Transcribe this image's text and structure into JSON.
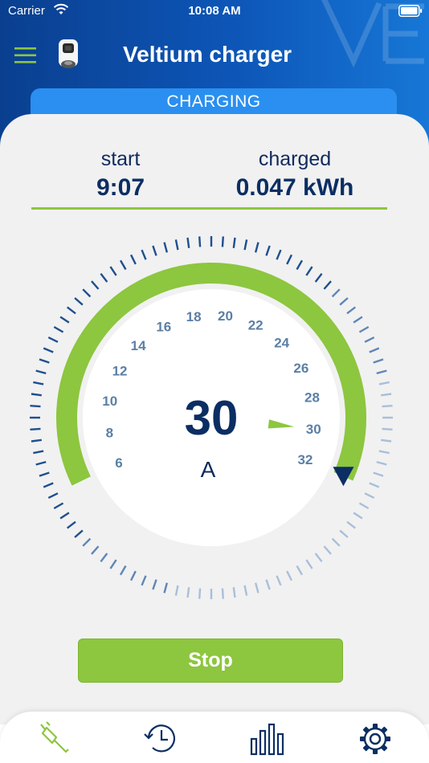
{
  "status_bar": {
    "carrier": "Carrier",
    "time": "10:08 AM"
  },
  "header": {
    "title": "Veltium charger"
  },
  "charging_state": "CHARGING",
  "stats": {
    "start_label": "start",
    "start_value": "9:07",
    "charged_label": "charged",
    "charged_value": "0.047 kWh"
  },
  "gauge": {
    "current_value": "30",
    "unit": "A",
    "scale_labels": [
      "6",
      "8",
      "10",
      "12",
      "14",
      "16",
      "18",
      "20",
      "22",
      "24",
      "26",
      "28",
      "30",
      "32"
    ],
    "needle_value": 30,
    "max_current_marker": 32
  },
  "actions": {
    "stop_label": "Stop"
  },
  "tab_bar": {
    "tabs": [
      {
        "icon": "charging-plug-icon",
        "active": true
      },
      {
        "icon": "history-icon",
        "active": false
      },
      {
        "icon": "statistics-icon",
        "active": false
      },
      {
        "icon": "settings-gear-icon",
        "active": false
      }
    ]
  },
  "colors": {
    "header_blue": "#0d56b8",
    "tab_blue": "#2a8ff0",
    "accent_green": "#8dc63f",
    "text_navy": "#0b2e63",
    "scale_label": "#5b7fa6"
  }
}
